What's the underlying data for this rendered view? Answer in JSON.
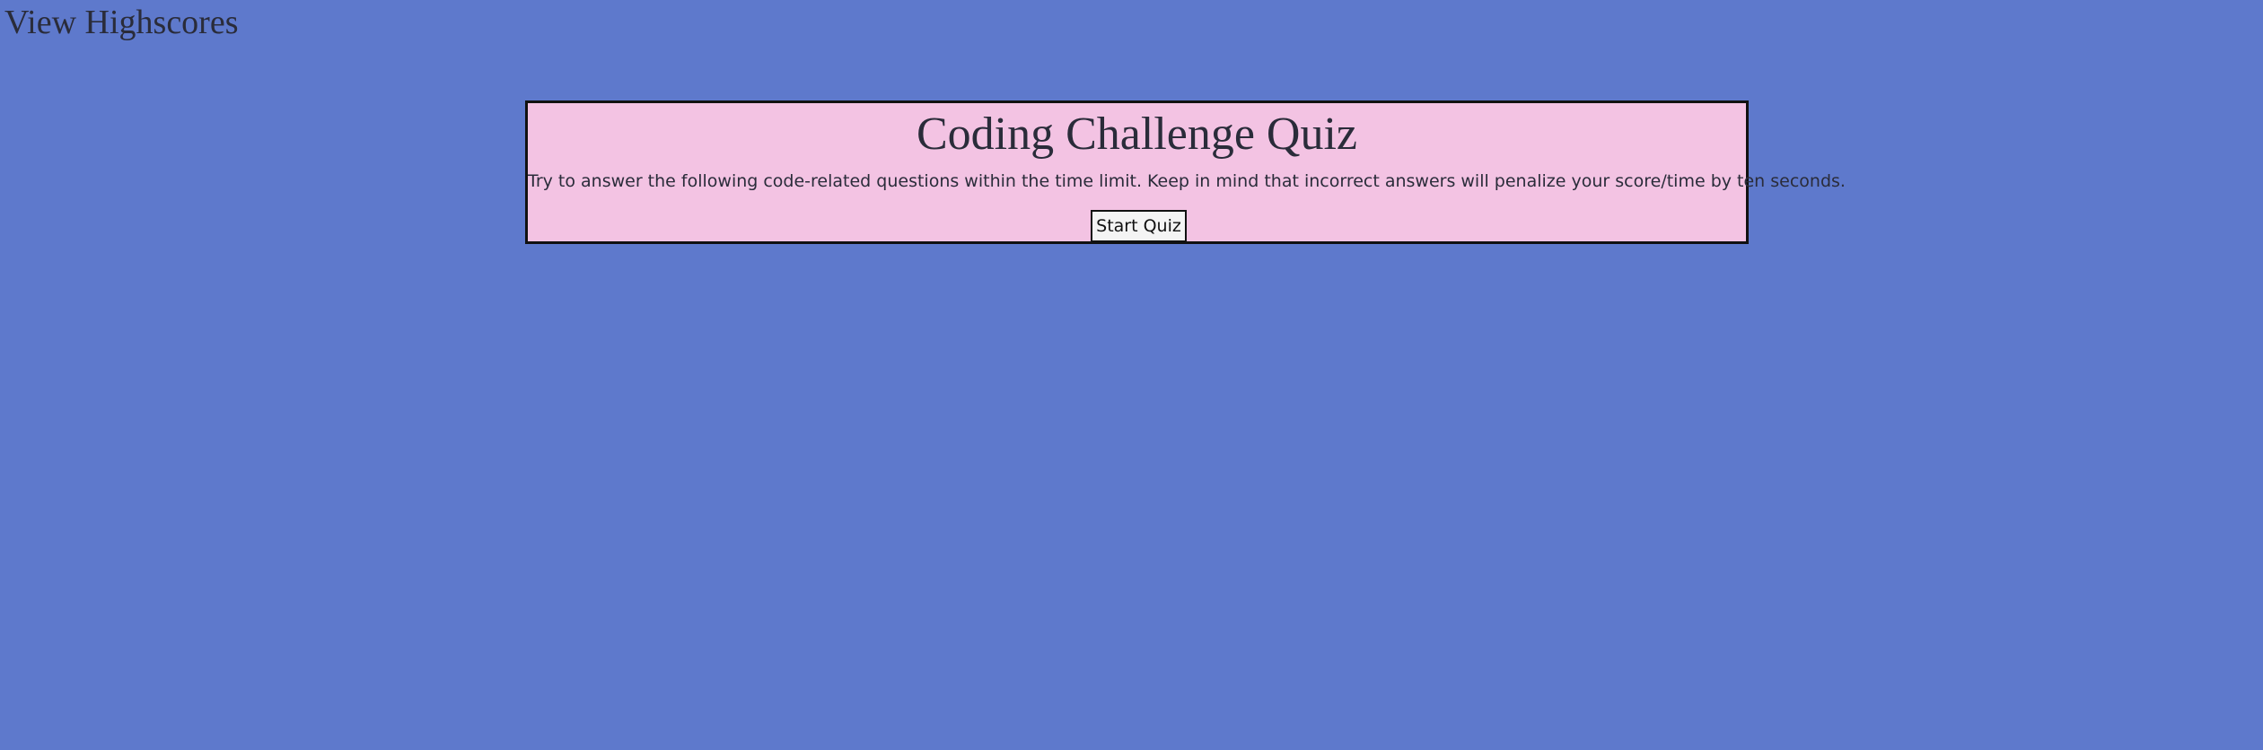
{
  "header": {
    "highscores_link": "View Highscores"
  },
  "quiz": {
    "title": "Coding Challenge Quiz",
    "description": "Try to answer the following code-related questions within the time limit. Keep in mind that incorrect answers will penalize your score/time by ten seconds.",
    "start_label": "Start Quiz"
  },
  "colors": {
    "page_background": "#5e79cc",
    "card_background": "#f3c3e3",
    "card_border": "#111111",
    "text": "#2a2c3a",
    "button_background": "#f4f4f4"
  }
}
